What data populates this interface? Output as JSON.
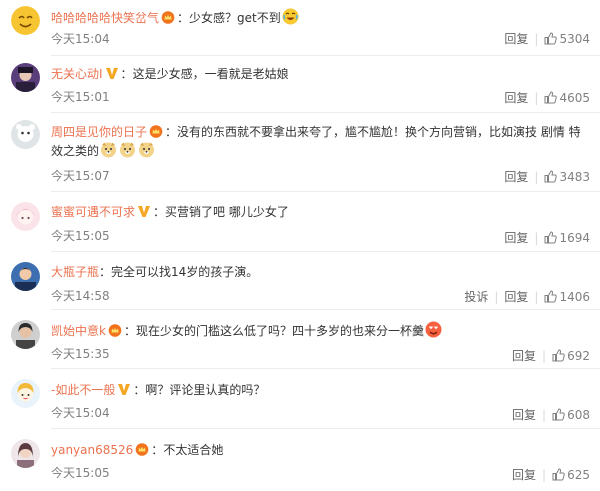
{
  "comments": [
    {
      "user": "哈哈哈哈哈快笑岔气",
      "text": "少女感？get不到",
      "time": "今天15:04",
      "reply": "回复",
      "likes": "5304"
    },
    {
      "user": "无关心动I",
      "text": "这是少女感，一看就是老姑娘",
      "time": "今天15:01",
      "reply": "回复",
      "likes": "4605"
    },
    {
      "user": "周四是见你的日子",
      "text": "没有的东西就不要拿出来夸了，尴不尴尬！换个方向营销，比如演技 剧情 特效之类的",
      "time": "今天15:07",
      "reply": "回复",
      "likes": "3483"
    },
    {
      "user": "蜜蜜可遇不可求",
      "text": "买营销了吧 哪儿少女了",
      "time": "今天15:05",
      "reply": "回复",
      "likes": "1694"
    },
    {
      "user": "大瓶子瓶",
      "text": "完全可以找14岁的孩子演。",
      "time": "今天14:58",
      "report": "投诉",
      "reply": "回复",
      "likes": "1406"
    },
    {
      "user": "凯始中意k",
      "text": "现在少女的门槛这么低了吗？四十多岁的也来分一杯羹",
      "time": "今天15:35",
      "reply": "回复",
      "likes": "692"
    },
    {
      "user": "-如此不一般",
      "text": "啊？评论里认真的吗？",
      "time": "今天15:04",
      "reply": "回复",
      "likes": "608"
    },
    {
      "user": "yanyan68526",
      "text": "不太适合她",
      "time": "今天15:05",
      "reply": "回复",
      "likes": "625"
    }
  ],
  "colors": {
    "username": "#eb7350",
    "text": "#333333",
    "meta": "#808080",
    "divider": "#ececec"
  },
  "icons": [
    "vip-crown-icon",
    "verified-v-icon",
    "like-thumb-icon",
    "laugh-cry-emoji-icon",
    "doge-emoji-icon",
    "heart-eyes-emoji-icon"
  ]
}
